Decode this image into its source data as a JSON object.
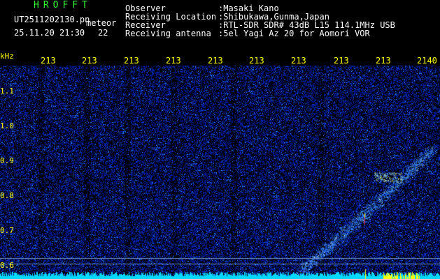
{
  "header": {
    "title": "HROFFT",
    "filename": "UT2511202130.pn",
    "mode": "meteor",
    "datetime": "25.11.20 21:30",
    "count": "22",
    "labels": {
      "observer": "Observer",
      "location": "Receiving Location",
      "receiver": "Receiver",
      "antenna": "Receiving antenna"
    },
    "values": {
      "observer": ":Masaki Kano",
      "location": ":Shibukawa,Gunma,Japan",
      "receiver": ":RTL-SDR SDR# 43dB L15 114.1MHz USB",
      "antenna": ":5el Yagi Az 20 for Aomori VOR"
    }
  },
  "time_scale": {
    "ticks": [
      "213",
      "213",
      "213",
      "213",
      "213",
      "213",
      "213",
      "213",
      "213",
      "2140"
    ]
  },
  "freq_axis": {
    "unit": "kHz",
    "ticks": [
      "1.1",
      "1.0",
      "0.9",
      "0.8",
      "0.7",
      "0.6"
    ]
  },
  "colors": {
    "background": "#000000",
    "noise": "#0a1aa8",
    "signal": "#55b0ff",
    "baseline": "#00e0ff",
    "text": "#ffffff",
    "title": "#33ff33",
    "scale": "#ffff00"
  }
}
